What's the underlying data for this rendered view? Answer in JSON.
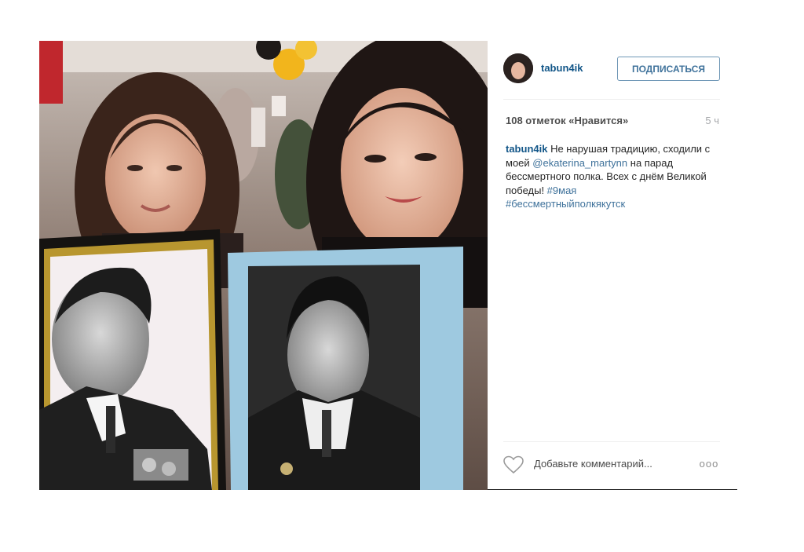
{
  "post": {
    "username": "tabun4ik",
    "follow_label": "ПОДПИСАТЬСЯ",
    "likes_text": "108 отметок «Нравится»",
    "time_text": "5 ч",
    "caption": {
      "author": "tabun4ik",
      "text_1": " Не нарушая традицию, сходили с моей ",
      "mention": "@ekaterina_martynn",
      "text_2": " на парад бессмертного полка. Всех с днём Великой победы! ",
      "hashtag_1": "#9мая",
      "hashtag_2": "#бессмертныйполкякутск"
    },
    "comment_placeholder": "Добавьте комментарий...",
    "more_label": "ooo"
  },
  "icons": {
    "like": "heart-icon",
    "more": "more-options-icon"
  },
  "colors": {
    "username": "#125688",
    "link": "#3f729b",
    "follow_border": "#6f97b6"
  }
}
